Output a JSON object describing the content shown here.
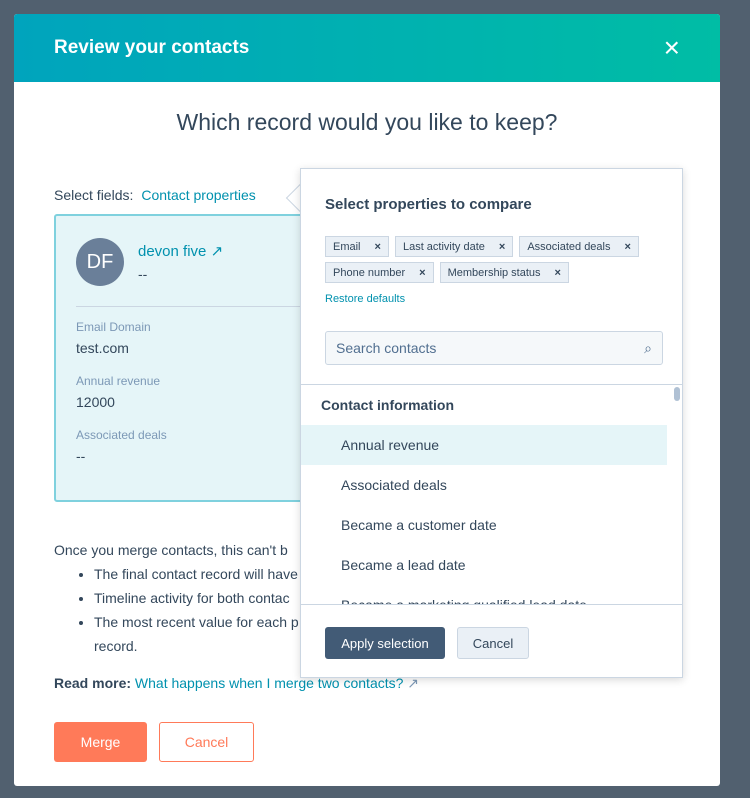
{
  "modal": {
    "title": "Review your contacts",
    "close_icon": "×",
    "question": "Which record would you like to keep?"
  },
  "select_fields": {
    "label": "Select fields:",
    "link": "Contact properties"
  },
  "card": {
    "initials": "DF",
    "name": "devon five",
    "subtitle": "--",
    "fields": [
      {
        "label": "Email Domain",
        "value": "test.com"
      },
      {
        "label": "Annual revenue",
        "value": "12000"
      },
      {
        "label": "Associated deals",
        "value": "--"
      }
    ]
  },
  "info": {
    "heading": "Once you merge contacts, this can't b",
    "bullets": [
      "The final contact record will have",
      "Timeline activity for both contac",
      "The most recent value for each p"
    ],
    "bullet_cont": "record."
  },
  "read_more": {
    "label": "Read more:",
    "link": "What happens when I merge two contacts?"
  },
  "buttons": {
    "merge": "Merge",
    "cancel": "Cancel"
  },
  "popover": {
    "title": "Select properties to compare",
    "tags": [
      "Email",
      "Last activity date",
      "Associated deals",
      "Phone number",
      "Membership status"
    ],
    "restore": "Restore defaults",
    "search_placeholder": "Search contacts",
    "group": "Contact information",
    "options": [
      "Annual revenue",
      "Associated deals",
      "Became a customer date",
      "Became a lead date",
      "Became a marketing qualified lead date"
    ],
    "apply": "Apply selection",
    "cancel": "Cancel"
  }
}
